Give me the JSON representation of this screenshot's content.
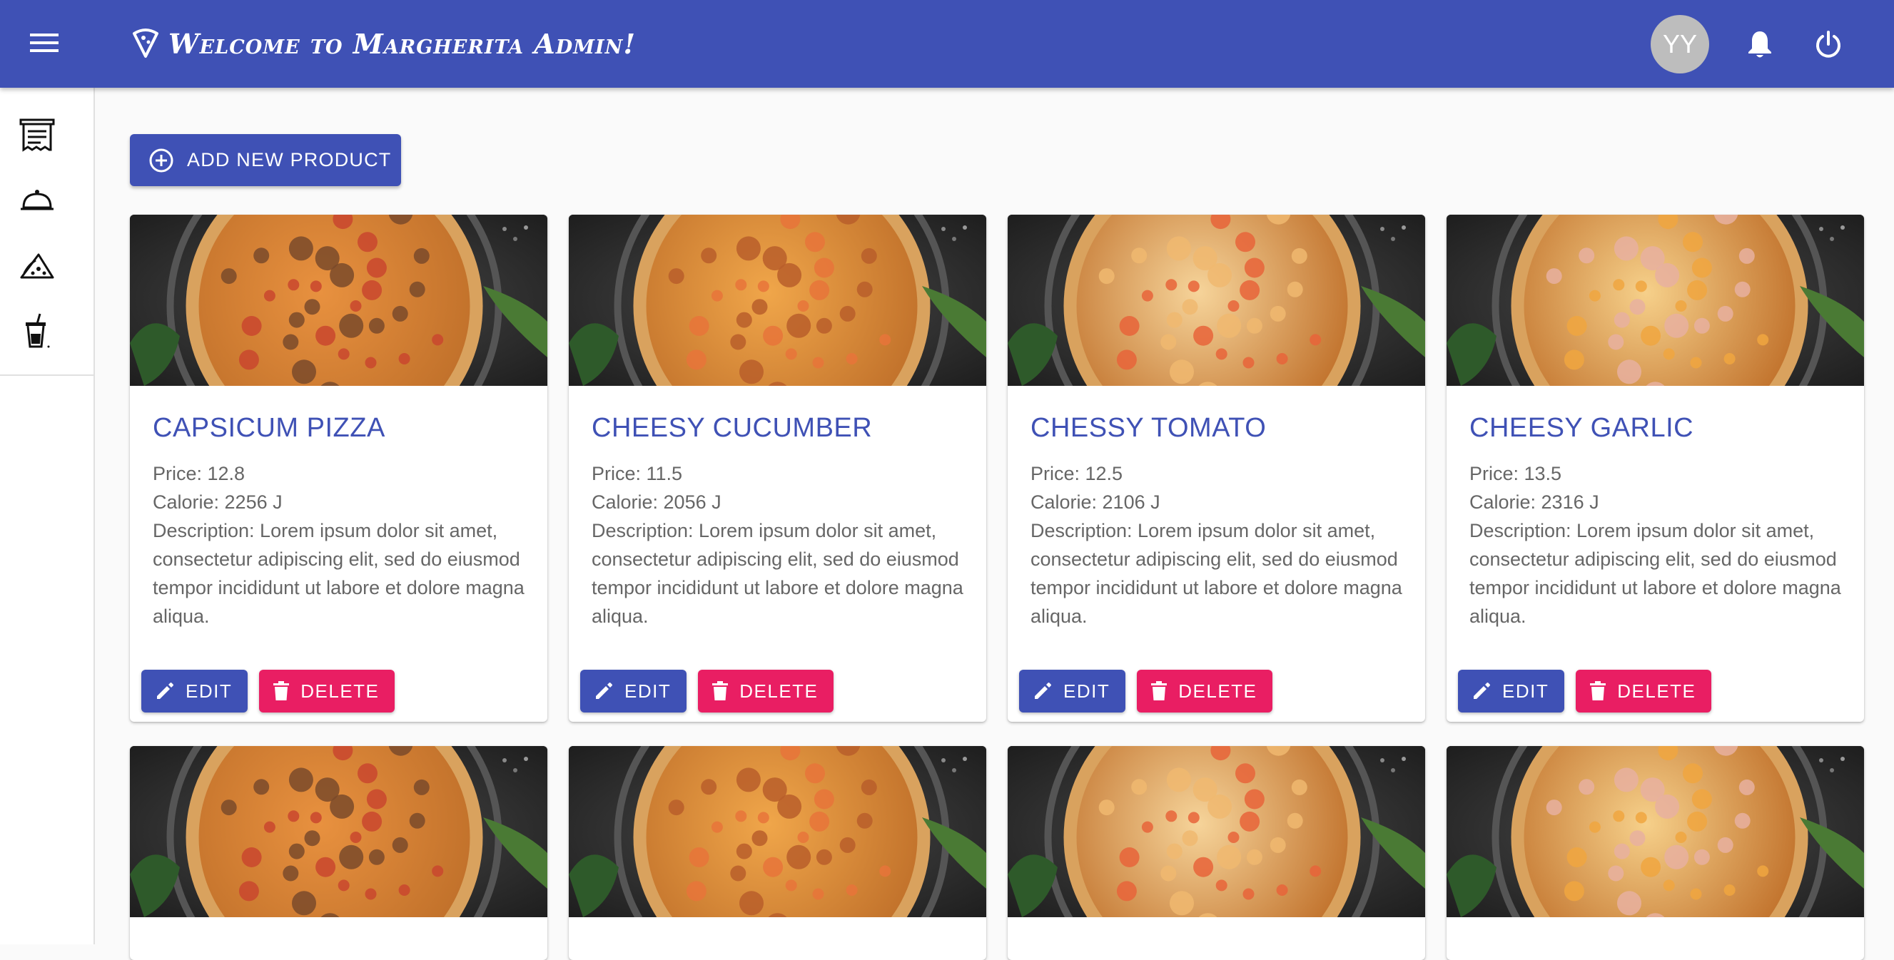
{
  "header": {
    "title": "Welcome to Margherita Admin!",
    "avatar_initials": "YY",
    "menu_icon": "menu-icon",
    "notifications_icon": "bell-icon",
    "logout_icon": "power-icon",
    "brand_color": "#3f51b5"
  },
  "sidebar": {
    "items": [
      {
        "name": "receipt-icon"
      },
      {
        "name": "cloche-icon"
      },
      {
        "name": "pizza-slice-icon"
      },
      {
        "name": "drink-icon"
      }
    ]
  },
  "main": {
    "add_button_label": "ADD NEW PRODUCT",
    "edit_label": "EDIT",
    "delete_label": "DELETE",
    "accent_delete": "#e91e63",
    "products": [
      {
        "name": "CAPSICUM PIZZA",
        "price": "Price: 12.8",
        "calorie": "Calorie: 2256 J",
        "description": "Description: Lorem ipsum dolor sit amet, consectetur adipiscing elit, sed do eiusmod tempor incididunt ut labore et dolore magna aliqua."
      },
      {
        "name": "CHEESY CUCUMBER",
        "price": "Price: 11.5",
        "calorie": "Calorie: 2056 J",
        "description": "Description: Lorem ipsum dolor sit amet, consectetur adipiscing elit, sed do eiusmod tempor incididunt ut labore et dolore magna aliqua."
      },
      {
        "name": "CHESSY TOMATO",
        "price": "Price: 12.5",
        "calorie": "Calorie: 2106 J",
        "description": "Description: Lorem ipsum dolor sit amet, consectetur adipiscing elit, sed do eiusmod tempor incididunt ut labore et dolore magna aliqua."
      },
      {
        "name": "CHEESY GARLIC",
        "price": "Price: 13.5",
        "calorie": "Calorie: 2316 J",
        "description": "Description: Lorem ipsum dolor sit amet, consectetur adipiscing elit, sed do eiusmod tempor incididunt ut labore et dolore magna aliqua."
      }
    ]
  }
}
